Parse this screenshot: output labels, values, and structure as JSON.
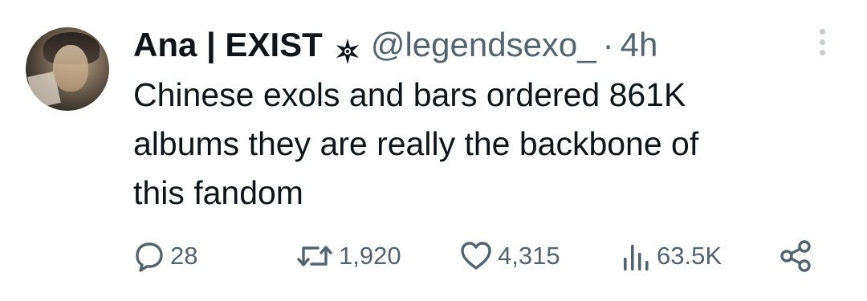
{
  "tweet": {
    "author_name": "Ana | EXIST",
    "handle": "@legendsexo_",
    "separator": "·",
    "time": "4h",
    "text": "Chinese exols and bars ordered 861K\nalbums they are really the backbone of\nthis fandom"
  },
  "actions": {
    "replies": "28",
    "reposts": "1,920",
    "likes": "4,315",
    "views": "63.5K"
  },
  "icons": {
    "badge": "flower-badge-icon",
    "more": "more-vertical-icon",
    "reply": "reply-icon",
    "repost": "repost-icon",
    "like": "heart-icon",
    "views": "views-chart-icon",
    "share": "share-icon"
  },
  "colors": {
    "text": "#0f1419",
    "secondary": "#536471",
    "more_dots": "#c7ccd1"
  }
}
